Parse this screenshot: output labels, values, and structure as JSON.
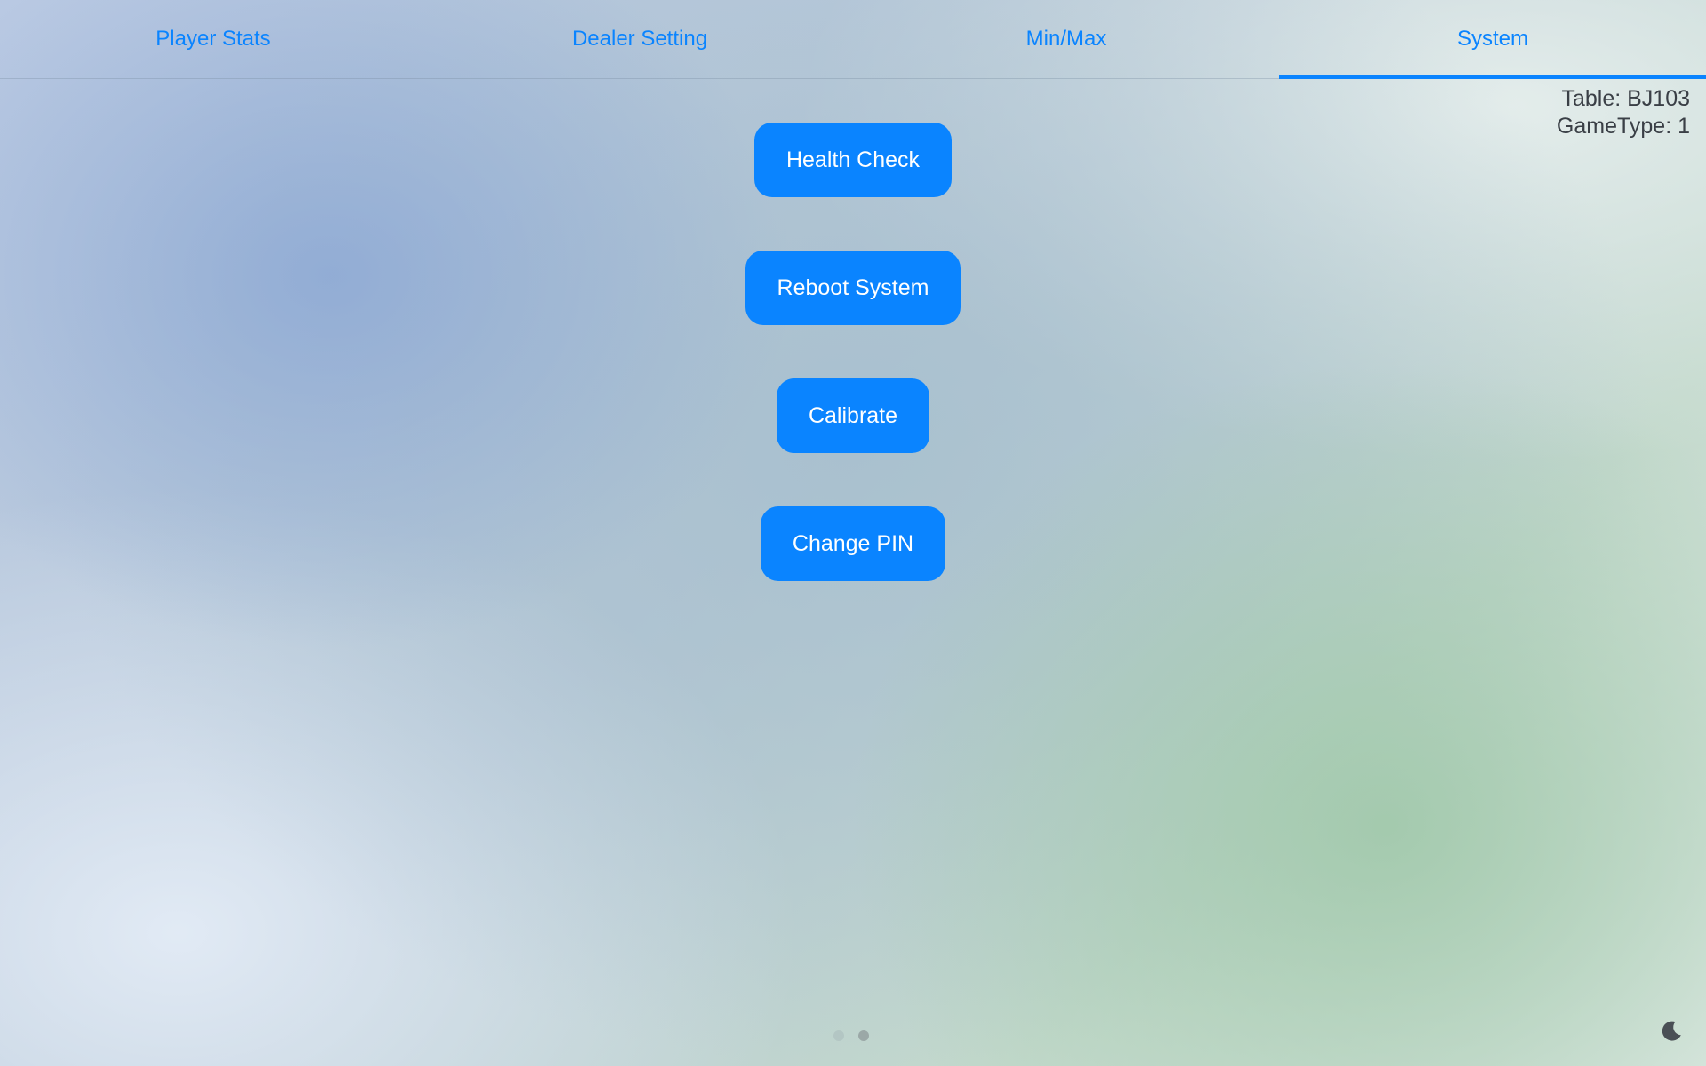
{
  "tabs": [
    {
      "label": "Player Stats",
      "active": false
    },
    {
      "label": "Dealer Setting",
      "active": false
    },
    {
      "label": "Min/Max",
      "active": false
    },
    {
      "label": "System",
      "active": true
    }
  ],
  "table_info": {
    "table": "Table: BJ103",
    "game_type": "GameType: 1"
  },
  "actions": {
    "health_check": "Health Check",
    "reboot_system": "Reboot System",
    "calibrate": "Calibrate",
    "change_pin": "Change PIN"
  },
  "pager": {
    "page_count": 2,
    "current_page": 2
  },
  "icons": {
    "theme_toggle": "moon-icon"
  },
  "colors": {
    "accent": "#0a84ff",
    "button_text": "#ffffff",
    "info_text": "#3a3f46"
  }
}
